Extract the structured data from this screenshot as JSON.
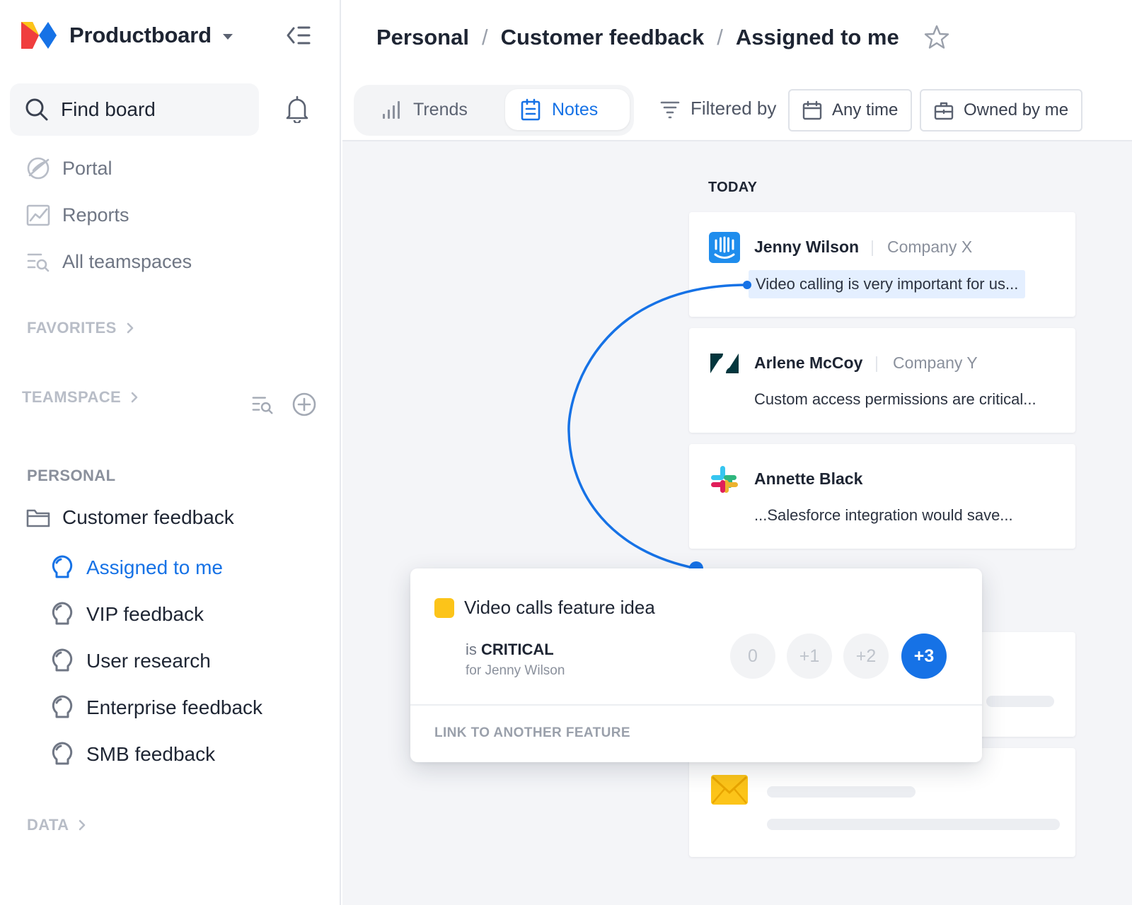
{
  "app": {
    "name": "Productboard"
  },
  "sidebar": {
    "search_label": "Find board",
    "nav": [
      {
        "label": "Portal",
        "icon": "portal-icon"
      },
      {
        "label": "Reports",
        "icon": "reports-icon"
      },
      {
        "label": "All teamspaces",
        "icon": "teamspaces-icon"
      }
    ],
    "favorites_label": "FAVORITES",
    "teamspace_label": "TEAMSPACE",
    "personal_label": "PERSONAL",
    "folder_label": "Customer feedback",
    "boards": [
      {
        "label": "Assigned to me",
        "active": true
      },
      {
        "label": "VIP feedback",
        "active": false
      },
      {
        "label": "User research",
        "active": false
      },
      {
        "label": "Enterprise feedback",
        "active": false
      },
      {
        "label": "SMB feedback",
        "active": false
      }
    ],
    "data_label": "DATA"
  },
  "header": {
    "breadcrumb": [
      "Personal",
      "Customer feedback",
      "Assigned to me"
    ],
    "tabs": {
      "trends": "Trends",
      "notes": "Notes",
      "active": "Notes"
    },
    "filtered_by_label": "Filtered by",
    "filters": {
      "time": "Any time",
      "owner": "Owned by me"
    }
  },
  "feed": {
    "group_label": "TODAY",
    "notes": [
      {
        "source": "intercom-icon",
        "name": "Jenny Wilson",
        "company": "Company X",
        "snippet": "Video calling is very important for us..."
      },
      {
        "source": "zendesk-icon",
        "name": "Arlene McCoy",
        "company": "Company Y",
        "snippet": "Custom access permissions are critical..."
      },
      {
        "source": "slack-icon",
        "name": "Annette Black",
        "company": "",
        "snippet": "...Salesforce integration would save..."
      }
    ],
    "placeholder_icon": "email-icon"
  },
  "insight_popup": {
    "feature": "Video calls feature idea",
    "is_prefix": "is",
    "importance": "CRITICAL",
    "for_text": "for Jenny Wilson",
    "scores": [
      "0",
      "+1",
      "+2",
      "+3"
    ],
    "selected_score": "+3",
    "link_label": "LINK TO ANOTHER FEATURE"
  },
  "colors": {
    "accent": "#1672e6",
    "feature_square": "#fcc419",
    "highlight": "#e4efff"
  }
}
